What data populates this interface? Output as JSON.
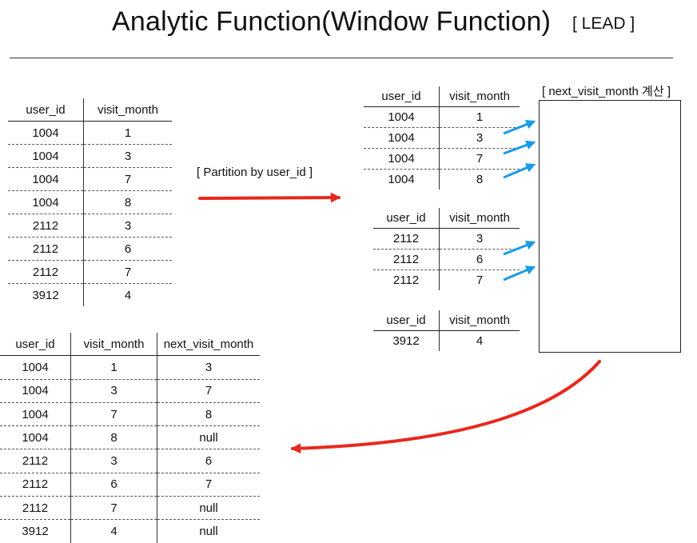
{
  "title": "Analytic Function(Window Function)",
  "function_tag": "[ LEAD ]",
  "partition_label": "[ Partition by user_id ]",
  "calc_label": "[ next_visit_month 계산 ]",
  "columns": {
    "user_id": "user_id",
    "visit_month": "visit_month",
    "next_visit_month": "next_visit_month"
  },
  "source_rows": [
    {
      "user_id": "1004",
      "visit_month": "1"
    },
    {
      "user_id": "1004",
      "visit_month": "3"
    },
    {
      "user_id": "1004",
      "visit_month": "7"
    },
    {
      "user_id": "1004",
      "visit_month": "8"
    },
    {
      "user_id": "2112",
      "visit_month": "3"
    },
    {
      "user_id": "2112",
      "visit_month": "6"
    },
    {
      "user_id": "2112",
      "visit_month": "7"
    },
    {
      "user_id": "3912",
      "visit_month": "4"
    }
  ],
  "partitions": [
    {
      "rows": [
        {
          "user_id": "1004",
          "visit_month": "1"
        },
        {
          "user_id": "1004",
          "visit_month": "3"
        },
        {
          "user_id": "1004",
          "visit_month": "7"
        },
        {
          "user_id": "1004",
          "visit_month": "8"
        }
      ]
    },
    {
      "rows": [
        {
          "user_id": "2112",
          "visit_month": "3"
        },
        {
          "user_id": "2112",
          "visit_month": "6"
        },
        {
          "user_id": "2112",
          "visit_month": "7"
        }
      ]
    },
    {
      "rows": [
        {
          "user_id": "3912",
          "visit_month": "4"
        }
      ]
    }
  ],
  "result_rows": [
    {
      "user_id": "1004",
      "visit_month": "1",
      "next_visit_month": "3"
    },
    {
      "user_id": "1004",
      "visit_month": "3",
      "next_visit_month": "7"
    },
    {
      "user_id": "1004",
      "visit_month": "7",
      "next_visit_month": "8"
    },
    {
      "user_id": "1004",
      "visit_month": "8",
      "next_visit_month": "null"
    },
    {
      "user_id": "2112",
      "visit_month": "3",
      "next_visit_month": "6"
    },
    {
      "user_id": "2112",
      "visit_month": "6",
      "next_visit_month": "7"
    },
    {
      "user_id": "2112",
      "visit_month": "7",
      "next_visit_month": "null"
    },
    {
      "user_id": "3912",
      "visit_month": "4",
      "next_visit_month": "null"
    }
  ],
  "colors": {
    "flow_arrow": "#e8281e",
    "lead_arrow": "#1a9be8"
  }
}
